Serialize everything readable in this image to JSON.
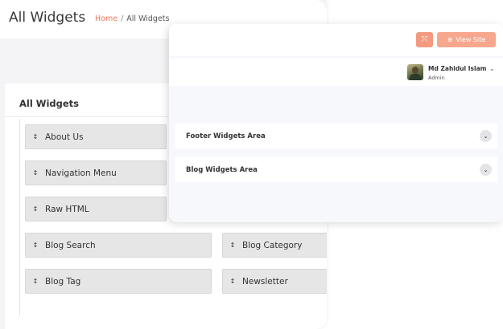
{
  "header": {
    "title": "All Widgets",
    "breadcrumb_home": "Home",
    "breadcrumb_separator": "/",
    "breadcrumb_current": "All Widgets"
  },
  "widgets_panel": {
    "title": "All Widgets",
    "items": [
      "About Us",
      "Navigation Menu",
      "Raw HTML",
      "Blog Search",
      "Blog Category",
      "Blog Tag",
      "Newsletter"
    ],
    "drag_glyph": "↕"
  },
  "topbar": {
    "expand_icon": "⤧",
    "view_site_label": "View Site",
    "view_site_icon": "⊕"
  },
  "user": {
    "name": "Md Zahidul Islam",
    "role": "Admin",
    "chevron": "⌄"
  },
  "widget_areas": [
    {
      "label": "Footer Widgets Area",
      "toggle": "⌄"
    },
    {
      "label": "Blog Widgets Area",
      "toggle": "⌄"
    }
  ],
  "colors": {
    "accent": "#f2785c",
    "button": "#f6a78d",
    "widget_bg": "#e6e6e6"
  }
}
